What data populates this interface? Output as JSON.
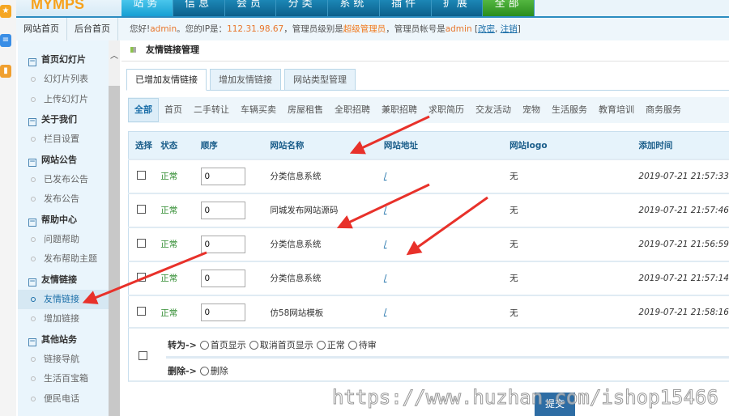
{
  "header": {
    "logo": "MYMPS",
    "nav": [
      "站务",
      "信息",
      "会员",
      "分类",
      "系统",
      "插件",
      "扩展",
      "全部"
    ]
  },
  "topbar": {
    "home": "网站首页",
    "admin_home": "后台首页",
    "greet": "您好!",
    "user": "admin",
    "ip_label": "。您的IP是：",
    "ip": "112.31.98.67",
    "level_label": "，管理员级别是",
    "level": "超级管理员",
    "account_label": "，管理员帐号是",
    "account": "admin",
    "change_pw": "改密",
    "logout": "注销"
  },
  "sidebar": {
    "groups": [
      {
        "title": "首页幻灯片",
        "items": [
          "幻灯片列表",
          "上传幻灯片"
        ]
      },
      {
        "title": "关于我们",
        "items": [
          "栏目设置"
        ]
      },
      {
        "title": "网站公告",
        "items": [
          "已发布公告",
          "发布公告"
        ]
      },
      {
        "title": "帮助中心",
        "items": [
          "问题帮助",
          "发布帮助主题"
        ]
      },
      {
        "title": "友情链接",
        "items": [
          "友情链接",
          "增加链接"
        ]
      },
      {
        "title": "其他站务",
        "items": [
          "链接导航",
          "生活百宝箱",
          "便民电话"
        ]
      }
    ]
  },
  "main": {
    "title": "友情链接管理",
    "tabs": [
      "已增加友情链接",
      "增加友情链接",
      "网站类型管理"
    ],
    "categories": [
      "全部",
      "首页",
      "二手转让",
      "车辆买卖",
      "房屋租售",
      "全职招聘",
      "兼职招聘",
      "求职简历",
      "交友活动",
      "宠物",
      "生活服务",
      "教育培训",
      "商务服务"
    ],
    "columns": [
      "选择",
      "状态",
      "顺序",
      "网站名称",
      "网站地址",
      "网站logo",
      "添加时间"
    ],
    "rows": [
      {
        "status": "正常",
        "order": "0",
        "name": "分类信息系统",
        "url": "/",
        "logo": "无",
        "time": "2019-07-21 21:57:33"
      },
      {
        "status": "正常",
        "order": "0",
        "name": "同城发布网站源码",
        "url": "/",
        "logo": "无",
        "time": "2019-07-21 21:57:46"
      },
      {
        "status": "正常",
        "order": "0",
        "name": "分类信息系统",
        "url": "/",
        "logo": "无",
        "time": "2019-07-21 21:56:59"
      },
      {
        "status": "正常",
        "order": "0",
        "name": "分类信息系统",
        "url": "/",
        "logo": "无",
        "time": "2019-07-21 21:57:14"
      },
      {
        "status": "正常",
        "order": "0",
        "name": "仿58网站模板",
        "url": "/",
        "logo": "无",
        "time": "2019-07-21 21:58:16"
      }
    ],
    "actions": {
      "convert_label": "转为->",
      "convert_options": [
        "首页显示",
        "取消首页显示",
        "正常",
        "待审"
      ],
      "delete_label": "删除->",
      "delete_option": "删除"
    },
    "submit": "提交"
  },
  "watermark": "https://www.huzhan.com/ishop15466",
  "colors": {
    "nav": "#0b5f8b",
    "accent": "#1a6ea8",
    "arrow": "#e8312a"
  }
}
